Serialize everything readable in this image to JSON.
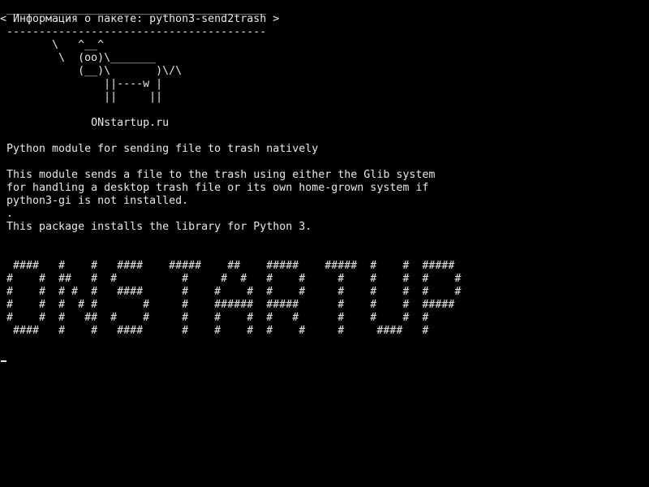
{
  "terminal": {
    "bubble": {
      "top_border": " ________________________________________",
      "title": "< Информация о пакете: python3-send2trash >",
      "bottom_border": " ----------------------------------------"
    },
    "cow": {
      "line1": "        \\   ^__^",
      "line2": "         \\  (oo)\\_______",
      "line3": "            (__)\\       )\\/\\",
      "line4": "                ||----w |",
      "line5": "                ||     ||"
    },
    "site": "              ONstartup.ru",
    "package": {
      "summary": " Python module for sending file to trash natively",
      "description": [
        " This module sends a file to the trash using either the Glib system",
        " for handling a desktop trash file or its own home-grown system if",
        " python3-gi is not installed.",
        " .",
        " This package installs the library for Python 3."
      ]
    },
    "banner": [
      "  ####   #    #   ####    #####    ##    #####    #####  #    #  #####",
      " #    #  ##   #  #          #     #  #   #    #     #    #    #  #    #",
      " #    #  # #  #   ####      #    #    #  #    #     #    #    #  #    #",
      " #    #  #  # #       #     #    ######  #####      #    #    #  #####",
      " #    #  #   ##  #    #     #    #    #  #   #      #    #    #  #",
      "  ####   #    #   ####      #    #    #  #    #     #     ####   #"
    ],
    "cursor_visible": true
  }
}
